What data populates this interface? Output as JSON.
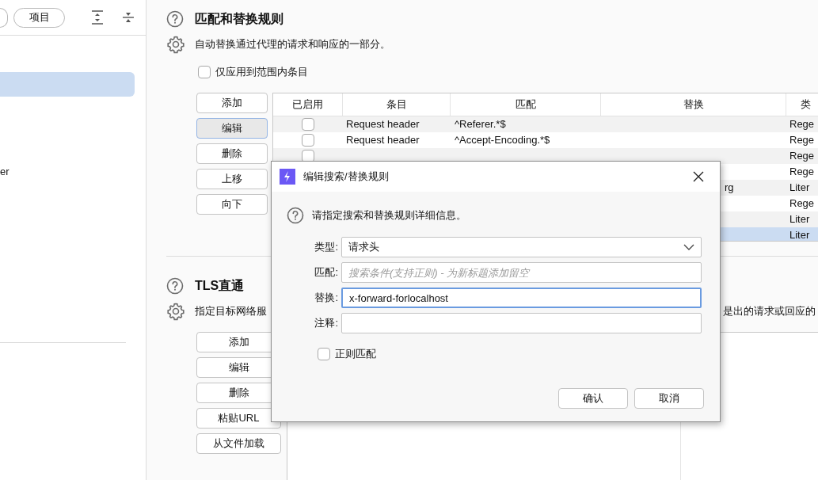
{
  "sidebar": {
    "toolbar": {
      "project_button": "项目"
    },
    "items": [
      {
        "selected": true
      },
      {
        "label": "er",
        "selected": false
      }
    ]
  },
  "match_replace": {
    "title": "匹配和替换规则",
    "description": "自动替换通过代理的请求和响应的一部分。",
    "scope_checkbox": {
      "label": "仅应用到范围内条目",
      "checked": false
    },
    "buttons": [
      {
        "label": "添加",
        "selected": false
      },
      {
        "label": "编辑",
        "selected": true
      },
      {
        "label": "删除",
        "selected": false
      },
      {
        "label": "上移",
        "selected": false
      },
      {
        "label": "向下",
        "selected": false
      }
    ],
    "table": {
      "columns": [
        "已启用",
        "条目",
        "匹配",
        "替换",
        "类"
      ],
      "rows": [
        {
          "enabled": false,
          "item": "Request header",
          "match": "^Referer.*$",
          "type": "Rege",
          "selected": false
        },
        {
          "enabled": false,
          "item": "Request header",
          "match": "^Accept-Encoding.*$",
          "type": "Rege",
          "selected": false
        },
        {
          "enabled": false,
          "type": "Rege",
          "selected": false
        },
        {
          "type": "Rege",
          "selected": false
        },
        {
          "replace": "rg",
          "type": "Liter",
          "selected": false
        },
        {
          "type": "Rege",
          "selected": false
        },
        {
          "type": "Liter",
          "selected": false
        },
        {
          "type": "Liter",
          "selected": true
        }
      ]
    }
  },
  "tls": {
    "title": "TLS直通",
    "description_start": "指定目标网络服",
    "description_end": "是出的请求或回应的",
    "buttons": [
      "添加",
      "编辑",
      "删除",
      "粘贴URL",
      "从文件加载"
    ]
  },
  "dialog": {
    "title": "编辑搜索/替换规则",
    "prompt": "请指定搜索和替换规则详细信息。",
    "fields": [
      {
        "kind": "select",
        "label": "类型:",
        "value": "请求头",
        "focused": false
      },
      {
        "kind": "text",
        "label": "匹配:",
        "placeholder": "搜索条件(支持正则) - 为新标题添加留空",
        "focused": false
      },
      {
        "kind": "text",
        "label": "替换:",
        "value": "x-forward-forlocalhost",
        "focused": true
      },
      {
        "kind": "text",
        "label": "注释:",
        "focused": false
      }
    ],
    "regex_checkbox": {
      "label": "正则匹配",
      "checked": false
    },
    "buttons": [
      "确认",
      "取消"
    ]
  }
}
